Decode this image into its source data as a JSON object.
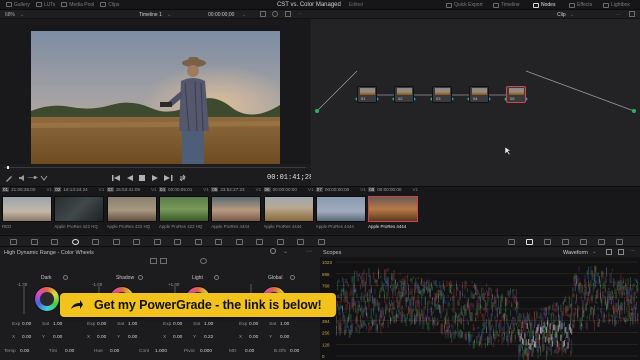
{
  "topbar": {
    "items": [
      {
        "label": "Gallery",
        "icon": "gallery-icon"
      },
      {
        "label": "LUTs",
        "icon": "luts-icon"
      },
      {
        "label": "Media Pool",
        "icon": "media-pool-icon"
      },
      {
        "label": "Clips",
        "icon": "clips-icon"
      }
    ],
    "project_title": "CST vs. Color Managed",
    "project_status": "Edited",
    "right_items": [
      {
        "label": "Quick Export",
        "active": false
      },
      {
        "label": "Timeline",
        "active": false
      },
      {
        "label": "Nodes",
        "active": true
      },
      {
        "label": "Effects",
        "active": false
      },
      {
        "label": "Lightbox",
        "active": false
      }
    ]
  },
  "viewer": {
    "zoom": "68%",
    "timeline_name": "Timeline 1",
    "header_timecode": "00:00:00;00",
    "timecode": "00:01:41;28"
  },
  "nodes": {
    "mode": "Clip",
    "labels": [
      "01",
      "02",
      "03",
      "04",
      "05"
    ],
    "selected": "05"
  },
  "clips": [
    {
      "num": "01",
      "tc": "21:05:35:00",
      "track": "V1",
      "codec": "RED",
      "thumb": "sky"
    },
    {
      "num": "02",
      "tc": "18:13:24:24",
      "track": "V1",
      "codec": "Apple ProRes 422 HQ",
      "thumb": "dark"
    },
    {
      "num": "03",
      "tc": "15:53:41:09",
      "track": "V1",
      "codec": "Apple ProRes 422 HQ",
      "thumb": "warm"
    },
    {
      "num": "04",
      "tc": "00:00:05:01",
      "track": "V1",
      "codec": "Apple ProRes 422 HQ",
      "thumb": "green"
    },
    {
      "num": "05",
      "tc": "23:52:27:23",
      "track": "V1",
      "codec": "Apple ProRes 4444",
      "thumb": "face"
    },
    {
      "num": "06",
      "tc": "00:00:00:00",
      "track": "V1",
      "codec": "Apple ProRes 4444",
      "thumb": "field"
    },
    {
      "num": "07",
      "tc": "00:00:00:00",
      "track": "V1",
      "codec": "Apple ProRes 4444",
      "thumb": "blue"
    },
    {
      "num": "08",
      "tc": "00:00:00:00",
      "track": "V1",
      "codec": "Apple ProRes 4444",
      "thumb": "sunset"
    }
  ],
  "selected_clip": "08",
  "wheels": {
    "title": "High Dynamic Range - Color Wheels",
    "zones": [
      {
        "name": "Dark",
        "value": "-1.30"
      },
      {
        "name": "Shadow",
        "value": "-1.00"
      },
      {
        "name": "Light",
        "value": "+1.00"
      },
      {
        "name": "Global",
        "value": ""
      }
    ],
    "exp_row": [
      {
        "exp": "0.00",
        "sat": "1.00"
      },
      {
        "exp": "0.00",
        "sat": "1.00"
      },
      {
        "exp": "0.00",
        "sat": "1.00"
      },
      {
        "exp": "0.00",
        "sat": "1.00"
      }
    ],
    "xy_row": [
      {
        "x": "0.00",
        "y": "0.00"
      },
      {
        "x": "0.00",
        "y": "0.00"
      },
      {
        "x": "0.00",
        "y": "0.22"
      },
      {
        "x": "0.00",
        "y": "0.00"
      }
    ],
    "bottom_row": [
      {
        "label": "Temp",
        "value": "0.00"
      },
      {
        "label": "Tint",
        "value": "0.00"
      },
      {
        "label": "Hue",
        "value": "0.00"
      },
      {
        "label": "Cont",
        "value": "1.000"
      },
      {
        "label": "Pivot",
        "value": "0.000"
      },
      {
        "label": "MD",
        "value": "0.00"
      },
      {
        "label": "B.Ofs",
        "value": "0.00"
      }
    ]
  },
  "scopes": {
    "title": "Scopes",
    "mode": "Waveform",
    "scale": [
      "1023",
      "896",
      "768",
      "640",
      "512",
      "384",
      "256",
      "128",
      "0"
    ]
  },
  "banner": {
    "text": "Get my PowerGrade - the link is below!"
  },
  "colors": {
    "accent": "#f2c31c",
    "selection": "#d04848",
    "node_green": "#2fb25a",
    "node_blue": "#3a86d8"
  }
}
